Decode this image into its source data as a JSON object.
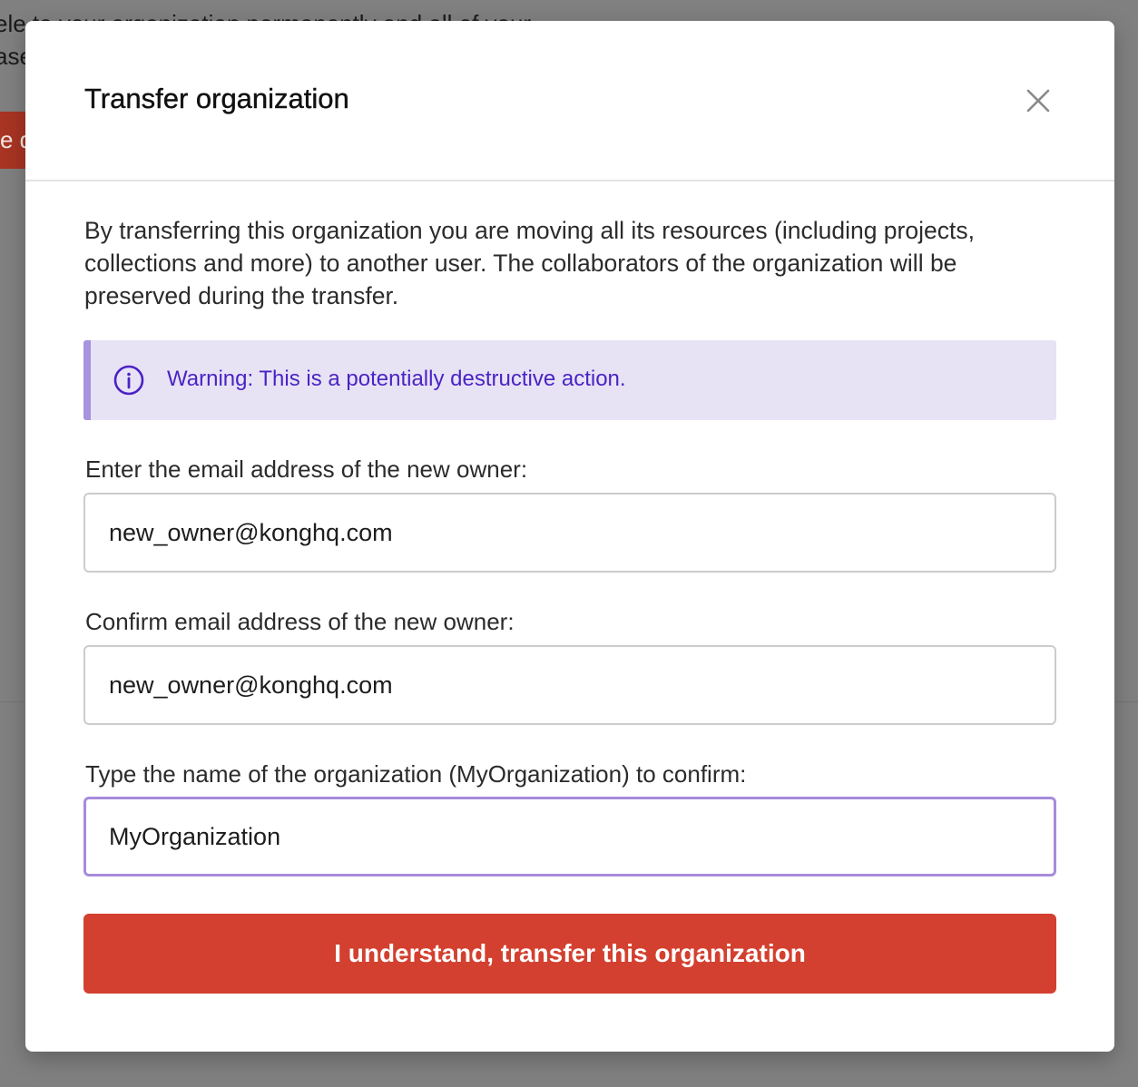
{
  "background": {
    "text_lines": [
      "ele to your organization permanently and all of your",
      "ase"
    ],
    "button_fragment": "e d"
  },
  "modal": {
    "title": "Transfer organization",
    "close_icon": "close-icon",
    "description": "By transferring this organization you are moving all its resources (including projects, collections and more) to another user. The collaborators of the organization will be preserved during the transfer.",
    "warning": {
      "icon": "info-circle-icon",
      "text": "Warning: This is a potentially destructive action."
    },
    "fields": {
      "email": {
        "label": "Enter the email address of the new owner:",
        "value": "new_owner@konghq.com"
      },
      "confirm_email": {
        "label": "Confirm email address of the new owner:",
        "value": "new_owner@konghq.com"
      },
      "org_name": {
        "label": "Type the name of the organization (MyOrganization) to confirm:",
        "value": "MyOrganization"
      }
    },
    "submit_label": "I understand, transfer this organization"
  },
  "colors": {
    "overlay": "#808080",
    "danger": "#d3402f",
    "warning_bg": "#e7e3f5",
    "warning_border": "#a793e0",
    "warning_text": "#4b23c4",
    "focus_border": "#a78bdc"
  }
}
